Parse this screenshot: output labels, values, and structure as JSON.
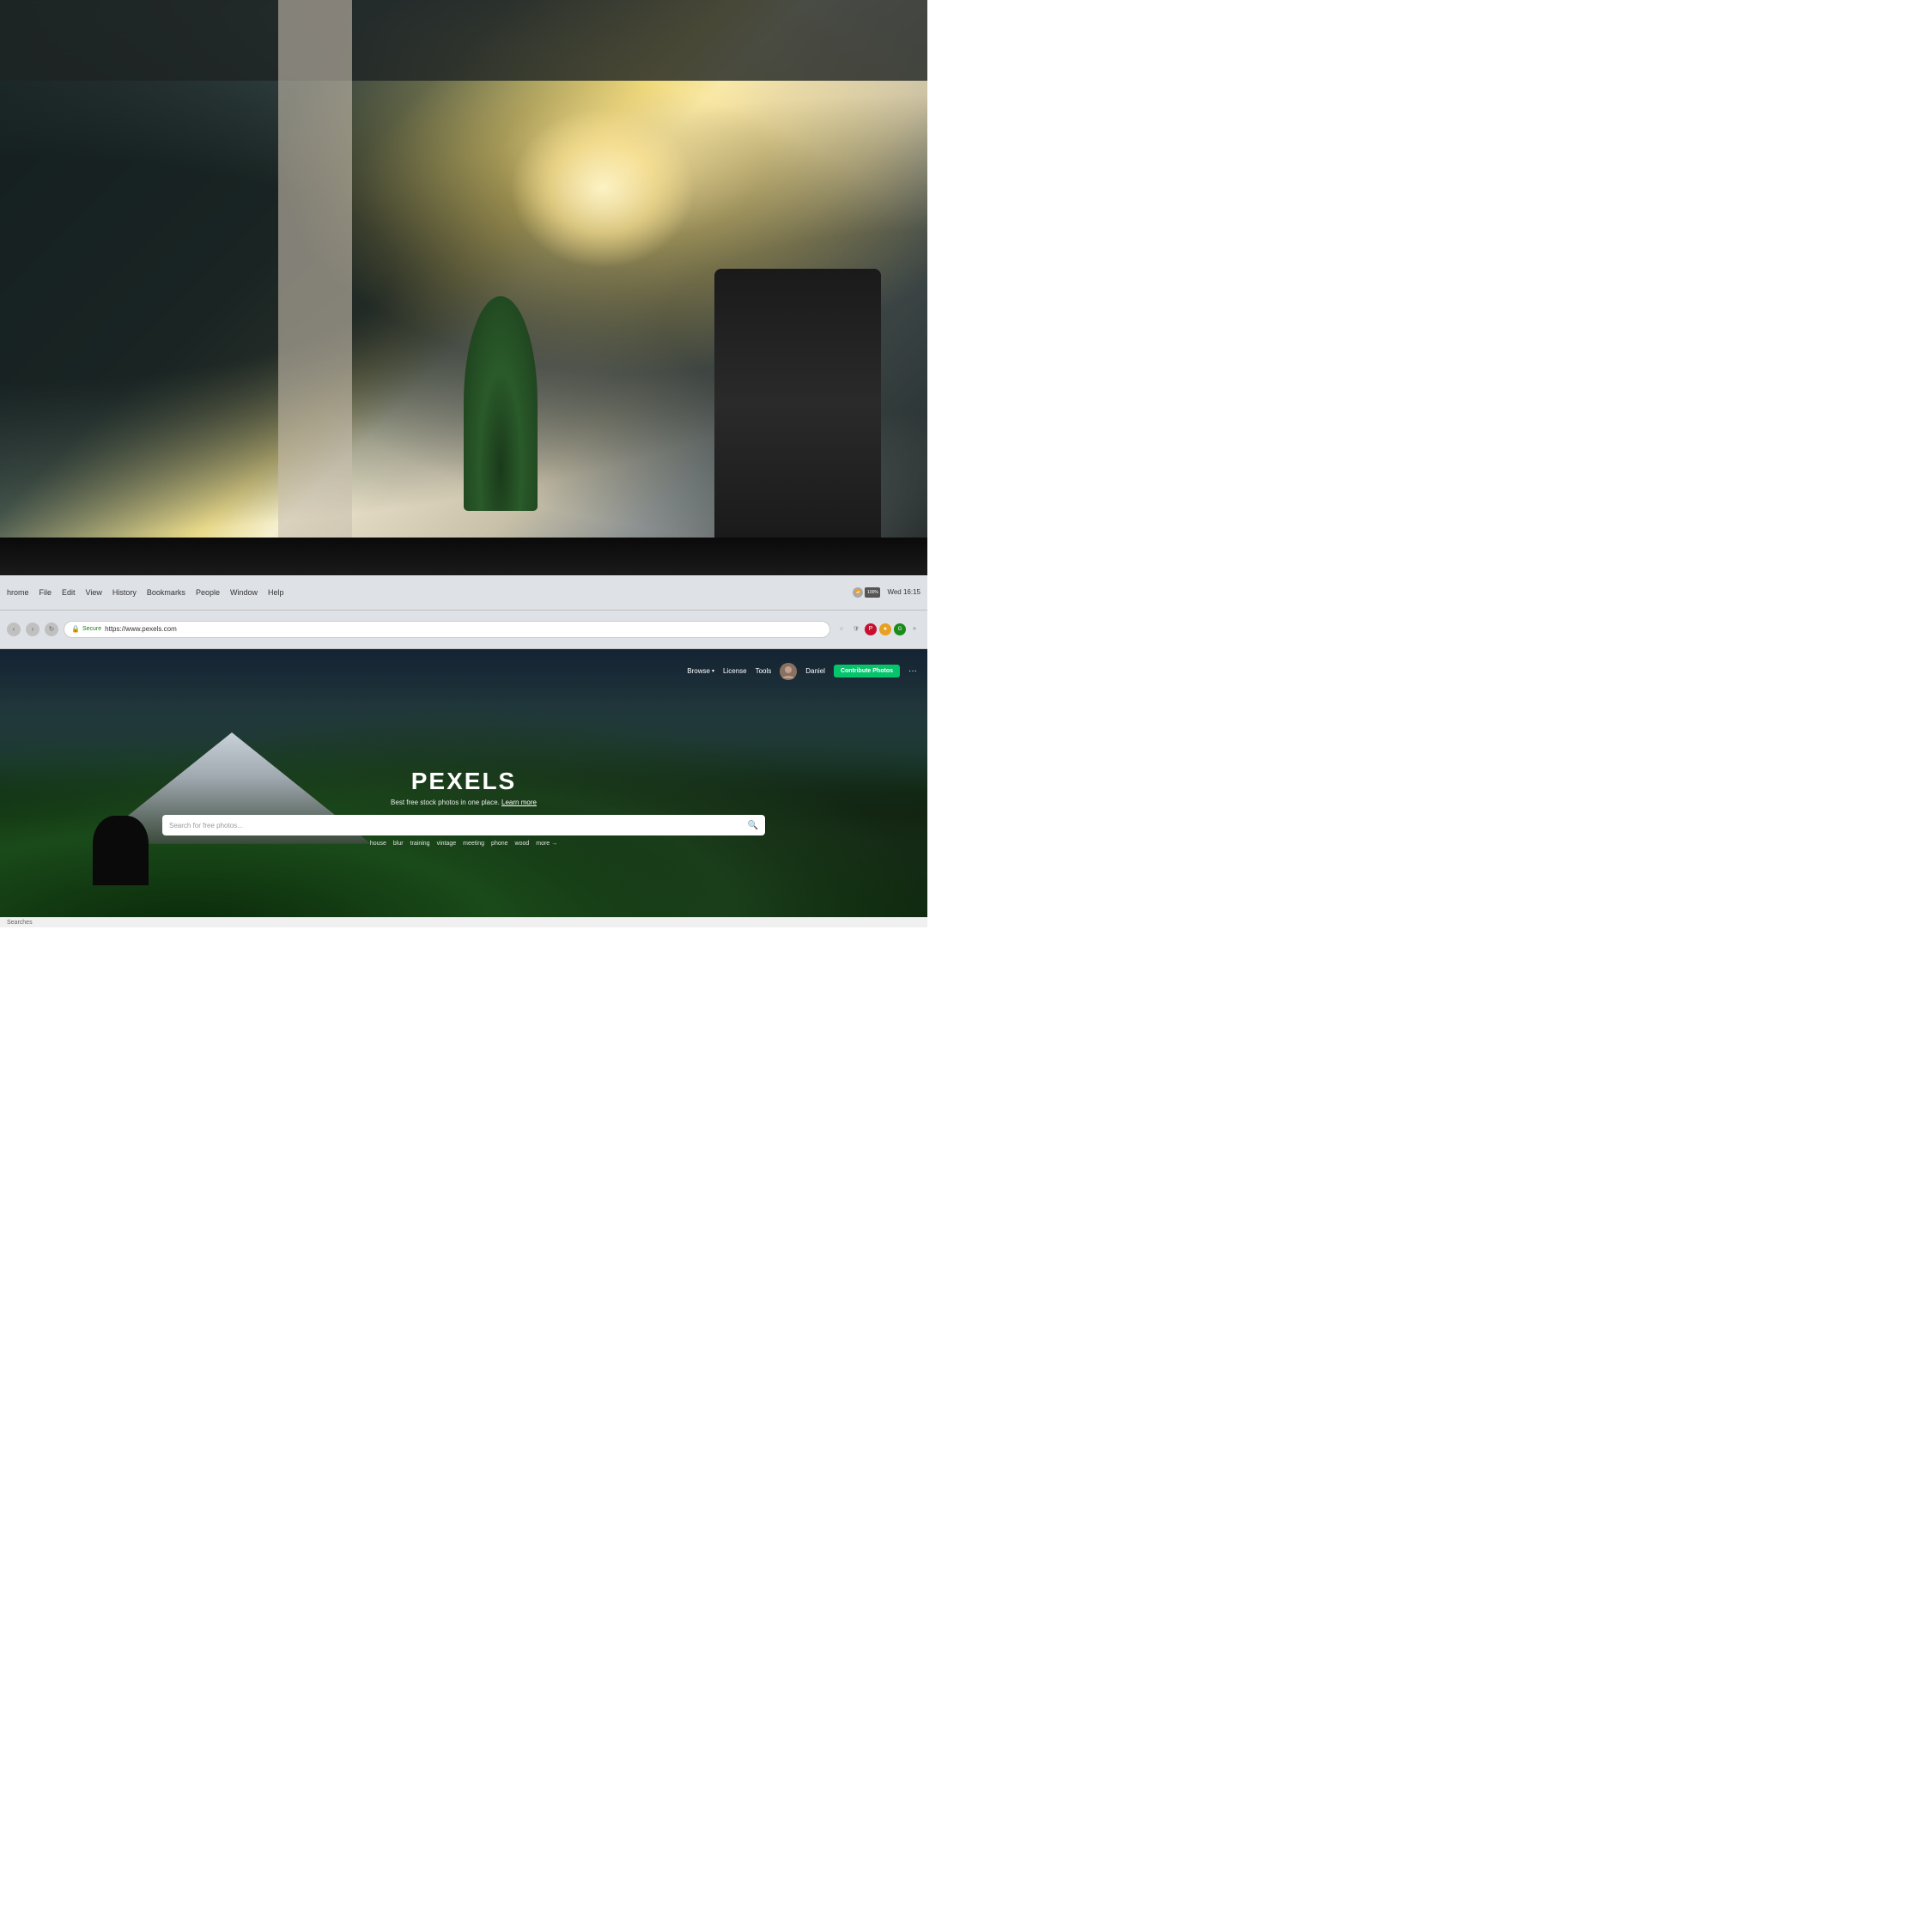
{
  "background": {
    "description": "Office interior with plants, chairs, windows, and ceiling beams"
  },
  "browser": {
    "menuItems": [
      "hrome",
      "File",
      "Edit",
      "View",
      "History",
      "Bookmarks",
      "People",
      "Window",
      "Help"
    ],
    "statusRight": "Wed 16:15",
    "battery": "100%",
    "url": "https://www.pexels.com",
    "secure_label": "Secure",
    "close_btn": "✕"
  },
  "pexels": {
    "nav": {
      "browse_label": "Browse",
      "license_label": "License",
      "tools_label": "Tools",
      "user_name": "Daniel",
      "contribute_label": "Contribute Photos",
      "more_label": "···"
    },
    "hero": {
      "logo": "PEXELS",
      "tagline": "Best free stock photos in one place.",
      "tagline_link": "Learn more",
      "search_placeholder": "Search for free photos...",
      "tags": [
        "house",
        "blur",
        "training",
        "vintage",
        "meeting",
        "phone",
        "wood"
      ],
      "more_tag": "more →"
    }
  },
  "status_bar": {
    "text": "Searches"
  }
}
